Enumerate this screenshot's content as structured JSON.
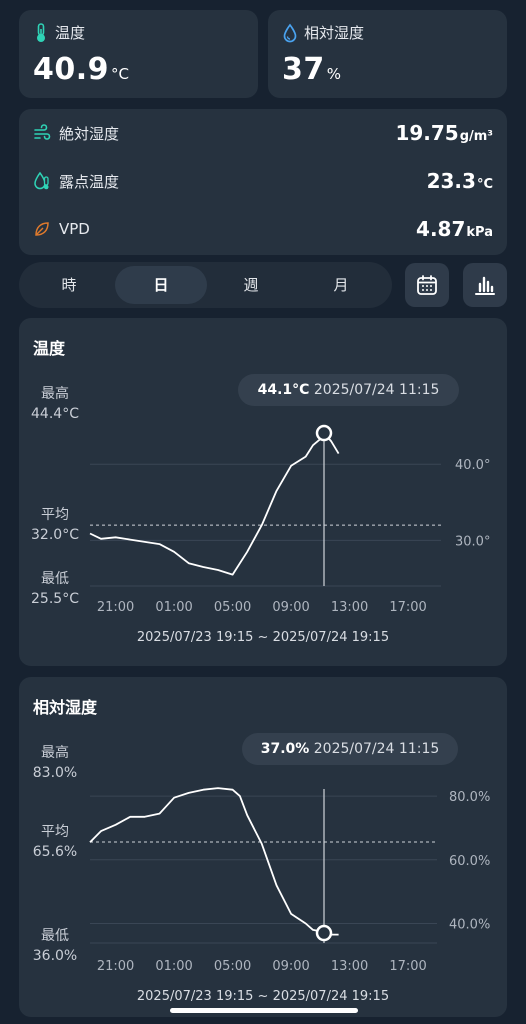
{
  "temperature": {
    "label": "温度",
    "value": "40.9",
    "unit": "°C"
  },
  "humidity": {
    "label": "相対湿度",
    "value": "37",
    "unit": "%"
  },
  "details": [
    {
      "label": "絶対湿度",
      "value": "19.75",
      "unit": "g/m³",
      "icon": "wind-icon",
      "color": "#2fd3b6"
    },
    {
      "label": "露点温度",
      "value": "23.3",
      "unit": "°C",
      "icon": "dew-point-icon",
      "color": "#2fd3b6"
    },
    {
      "label": "VPD",
      "value": "4.87",
      "unit": "kPa",
      "icon": "leaf-icon",
      "color": "#e07a2c"
    }
  ],
  "period_tabs": [
    "時",
    "日",
    "週",
    "月"
  ],
  "active_tab": "日",
  "colors": {
    "accent_teal": "#2fd3b6",
    "accent_blue": "#4aa3f0",
    "accent_orange": "#e07a2c",
    "background": "#172230",
    "card": "#26323f"
  },
  "temp_chart": {
    "title": "温度",
    "stat_max_label": "最高",
    "stat_max": "44.4°C",
    "stat_avg_label": "平均",
    "stat_avg": "32.0°C",
    "stat_min_label": "最低",
    "stat_min": "25.5°C",
    "tooltip_value": "44.1°C",
    "tooltip_time": "2025/07/24 11:15",
    "range": "2025/07/23 19:15 ~ 2025/07/24 19:15"
  },
  "hum_chart": {
    "title": "相対湿度",
    "stat_max_label": "最高",
    "stat_max": "83.0%",
    "stat_avg_label": "平均",
    "stat_avg": "65.6%",
    "stat_min_label": "最低",
    "stat_min": "36.0%",
    "tooltip_value": "37.0%",
    "tooltip_time": "2025/07/24 11:15",
    "range": "2025/07/23 19:15 ~ 2025/07/24 19:15"
  },
  "chart_data": [
    {
      "type": "line",
      "title": "温度",
      "x": [
        "19:15",
        "20:00",
        "21:00",
        "22:00",
        "23:00",
        "00:00",
        "01:00",
        "02:00",
        "03:00",
        "04:00",
        "05:00",
        "06:00",
        "07:00",
        "08:00",
        "09:00",
        "10:00",
        "10:30",
        "11:00",
        "11:15",
        "11:45",
        "12:15"
      ],
      "series": [
        {
          "values": [
            30.9,
            30.2,
            30.4,
            30.1,
            29.8,
            29.5,
            28.5,
            27.0,
            26.5,
            26.1,
            25.5,
            28.5,
            32.0,
            36.5,
            39.8,
            41.0,
            42.5,
            43.3,
            44.1,
            43.0,
            41.4
          ]
        }
      ],
      "ylim": [
        24,
        44.5
      ],
      "y_ticks": [
        "30.0°",
        "40.0°"
      ],
      "x_ticks": [
        "21:00",
        "01:00",
        "05:00",
        "09:00",
        "13:00",
        "17:00"
      ],
      "average": 32.0,
      "cursor_x": "11:15",
      "grid": true
    },
    {
      "type": "line",
      "title": "相対湿度",
      "x": [
        "19:15",
        "20:00",
        "21:00",
        "22:00",
        "23:00",
        "00:00",
        "00:30",
        "01:00",
        "02:00",
        "03:00",
        "04:00",
        "05:00",
        "05:30",
        "06:00",
        "07:00",
        "08:00",
        "09:00",
        "10:00",
        "10:30",
        "11:00",
        "11:15",
        "11:45",
        "12:15"
      ],
      "series": [
        {
          "values": [
            65.5,
            69.0,
            71.0,
            73.5,
            73.5,
            74.5,
            77.0,
            79.5,
            81.0,
            82.0,
            82.5,
            82.0,
            80.0,
            74.0,
            65.0,
            52.0,
            43.0,
            40.0,
            38.0,
            37.5,
            37.0,
            36.5,
            36.5
          ]
        }
      ],
      "ylim": [
        34.5,
        86
      ],
      "y_ticks": [
        "40.0%",
        "60.0%",
        "80.0%"
      ],
      "x_ticks": [
        "21:00",
        "01:00",
        "05:00",
        "09:00",
        "13:00",
        "17:00"
      ],
      "average": 65.6,
      "cursor_x": "11:15",
      "grid": true
    }
  ]
}
